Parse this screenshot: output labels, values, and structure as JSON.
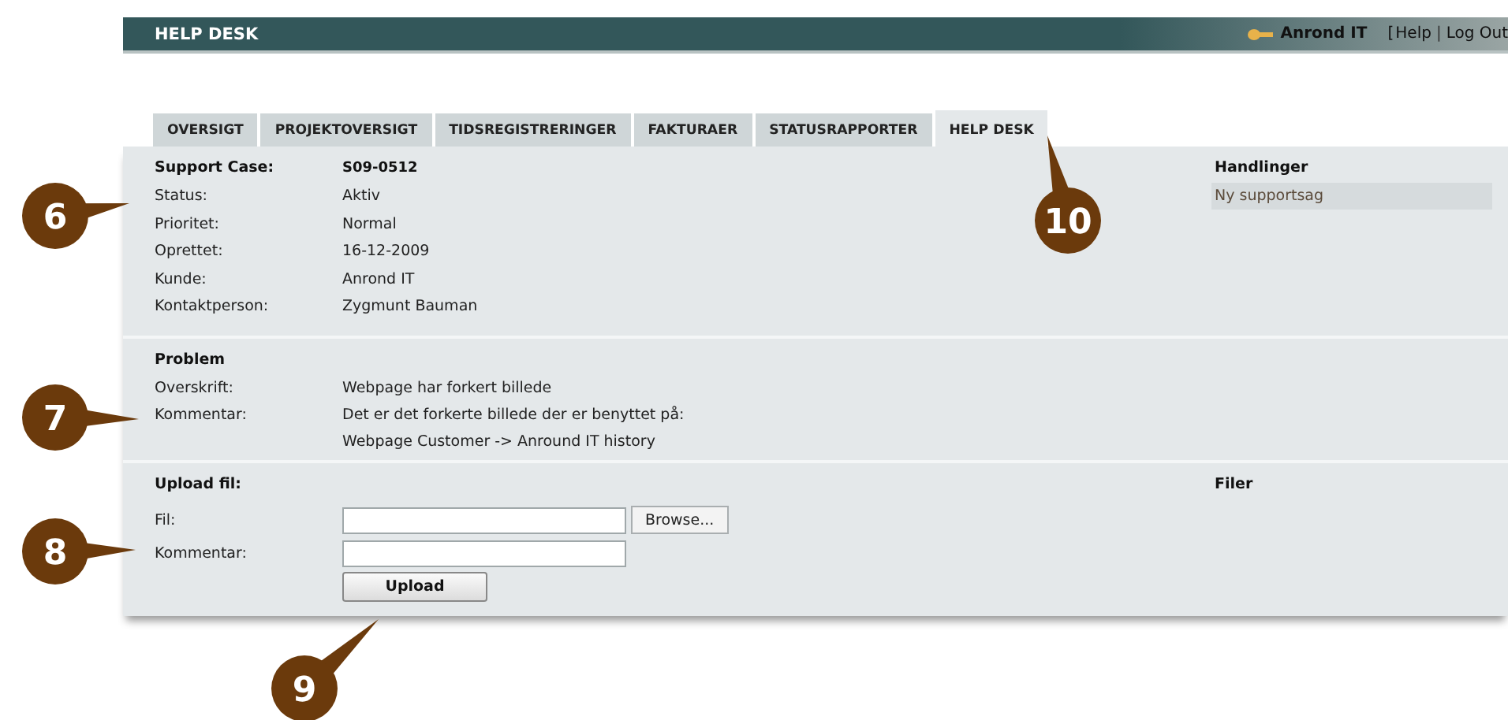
{
  "header": {
    "title": "HELP DESK",
    "user": "Anrond IT",
    "links": [
      {
        "kind": "bracket",
        "label": "["
      },
      {
        "kind": "link",
        "label": "Help"
      },
      {
        "kind": "sep",
        "label": "|"
      },
      {
        "kind": "link",
        "label": "Log Out"
      }
    ]
  },
  "tabs": [
    {
      "label": "OVERSIGT",
      "selected": false
    },
    {
      "label": "PROJEKTOVERSIGT",
      "selected": false
    },
    {
      "label": "TIDSREGISTRERINGER",
      "selected": false
    },
    {
      "label": "FAKTURAER",
      "selected": false
    },
    {
      "label": "STATUSRAPPORTER",
      "selected": false
    },
    {
      "label": "HELP DESK",
      "selected": true
    }
  ],
  "case": {
    "heading": "Support Case:",
    "number": "S09-0512",
    "fields": [
      {
        "label": "Status:",
        "value": [
          "Aktiv"
        ]
      },
      {
        "label": "Prioritet:",
        "value": [
          "Normal"
        ]
      },
      {
        "label": "Oprettet:",
        "value": [
          "16-12-2009"
        ]
      },
      {
        "label": "Kunde:",
        "value": [
          "Anrond IT"
        ]
      },
      {
        "label": "Kontaktperson:",
        "value": [
          "Zygmunt Bauman"
        ]
      }
    ]
  },
  "actions": {
    "heading": "Handlinger",
    "items": [
      "Ny supportsag"
    ]
  },
  "problem": {
    "heading": "Problem",
    "fields": [
      {
        "label": "Overskrift:",
        "value": [
          "Webpage har forkert billede"
        ]
      },
      {
        "label": "Kommentar:",
        "value": [
          "Det er det forkerte billede der er benyttet på:",
          "Webpage Customer -> Anround IT history"
        ]
      }
    ]
  },
  "upload": {
    "heading": "Upload fil:",
    "fields": [
      {
        "label": "Fil:",
        "kind": "file",
        "button": "Browse..."
      },
      {
        "label": "Kommentar:",
        "kind": "text"
      }
    ],
    "submit": "Upload"
  },
  "files": {
    "heading": "Filer"
  },
  "callouts": [
    {
      "number": "6"
    },
    {
      "number": "7"
    },
    {
      "number": "8"
    },
    {
      "number": "9"
    },
    {
      "number": "10"
    }
  ]
}
